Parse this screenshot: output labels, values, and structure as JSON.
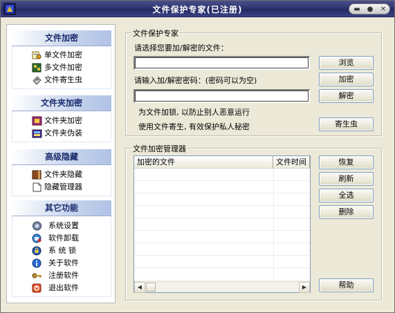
{
  "window": {
    "title": "文件保护专家(已注册)"
  },
  "sidebar": {
    "sections": [
      {
        "title": "文件加密",
        "items": [
          "单文件加密",
          "多文件加密",
          "文件寄生虫"
        ]
      },
      {
        "title": "文件夹加密",
        "items": [
          "文件夹加密",
          "文件夹伪装"
        ]
      },
      {
        "title": "高级隐藏",
        "items": [
          "文件夹隐藏",
          "隐藏管理器"
        ]
      },
      {
        "title": "其它功能",
        "items": [
          "系统设置",
          "软件卸载",
          "系 统 锁",
          "关于软件",
          "注册软件",
          "退出软件"
        ]
      }
    ]
  },
  "protect": {
    "group_title": "文件保护专家",
    "file_label": "请选择您要加/解密的文件：",
    "file_value": "",
    "password_label": "请输入加/解密密码：(密码可以为空)",
    "password_value": "",
    "hint1": "为文件加锁, 以防止别人恶意运行",
    "hint2": "使用文件寄生, 有效保护私人秘密",
    "buttons": {
      "browse": "浏览",
      "encrypt": "加密",
      "decrypt": "解密",
      "parasite": "寄生虫"
    }
  },
  "manager": {
    "group_title": "文件加密管理器",
    "columns": [
      "加密的文件",
      "文件时间"
    ],
    "rows": [],
    "buttons": {
      "restore": "恢复",
      "refresh": "刷新",
      "select_all": "全选",
      "delete": "删除",
      "help": "帮助"
    }
  },
  "colors": {
    "title_bar": "#2f3570",
    "section_header": "#c7d4ec",
    "face": "#ece9d8"
  }
}
